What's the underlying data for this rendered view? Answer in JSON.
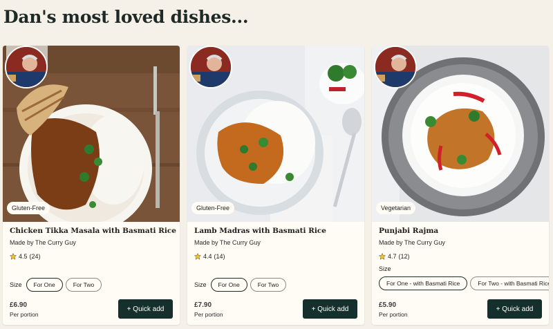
{
  "page": {
    "title": "Dan's most loved dishes..."
  },
  "colors": {
    "background": "#f5f1e8",
    "card": "#fffcf5",
    "button": "#15302c",
    "star": "#f2c230"
  },
  "cards": [
    {
      "name": "Chicken Tikka Masala with Basmati Rice",
      "maker": "Made by The Curry Guy",
      "diet": "Gluten-Free",
      "rating": "4.5",
      "reviews": "(24)",
      "size_label": "Size",
      "sizes": [
        "For One",
        "For Two"
      ],
      "selected_size": "For One",
      "price": "£6.90",
      "per": "Per portion",
      "button": "+ Quick add"
    },
    {
      "name": "Lamb Madras with Basmati Rice",
      "maker": "Made by The Curry Guy",
      "diet": "Gluten-Free",
      "rating": "4.4",
      "reviews": "(14)",
      "size_label": "Size",
      "sizes": [
        "For One",
        "For Two"
      ],
      "selected_size": "For One",
      "price": "£7.90",
      "per": "Per portion",
      "button": "+ Quick add"
    },
    {
      "name": "Punjabi Rajma",
      "maker": "Made by The Curry Guy",
      "diet": "Vegetarian",
      "rating": "4.7",
      "reviews": "(12)",
      "size_label": "Size",
      "sizes": [
        "For One - with Basmati Rice",
        "For Two - with Basmati Rice"
      ],
      "selected_size": "For One - with Basmati Rice",
      "price": "£5.90",
      "per": "Per portion",
      "button": "+ Quick add"
    }
  ]
}
